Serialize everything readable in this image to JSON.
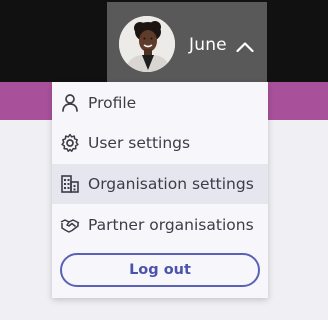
{
  "header": {
    "user_name": "June",
    "avatar_icon": "user-avatar-photo",
    "chevron_icon": "chevron-up-icon"
  },
  "menu": {
    "items": [
      {
        "label": "Profile",
        "icon": "person-icon"
      },
      {
        "label": "User settings",
        "icon": "gear-icon"
      },
      {
        "label": "Organisation settings",
        "icon": "building-icon"
      },
      {
        "label": "Partner organisations",
        "icon": "handshake-icon"
      }
    ],
    "logout_label": "Log out"
  },
  "colors": {
    "topbar": "#111111",
    "user_toggle": "#595959",
    "brand_purple": "#a8519a",
    "menu_bg": "#f7f7fb",
    "hover_bg": "#e6e6ee",
    "logout_accent": "#5a62b8"
  }
}
